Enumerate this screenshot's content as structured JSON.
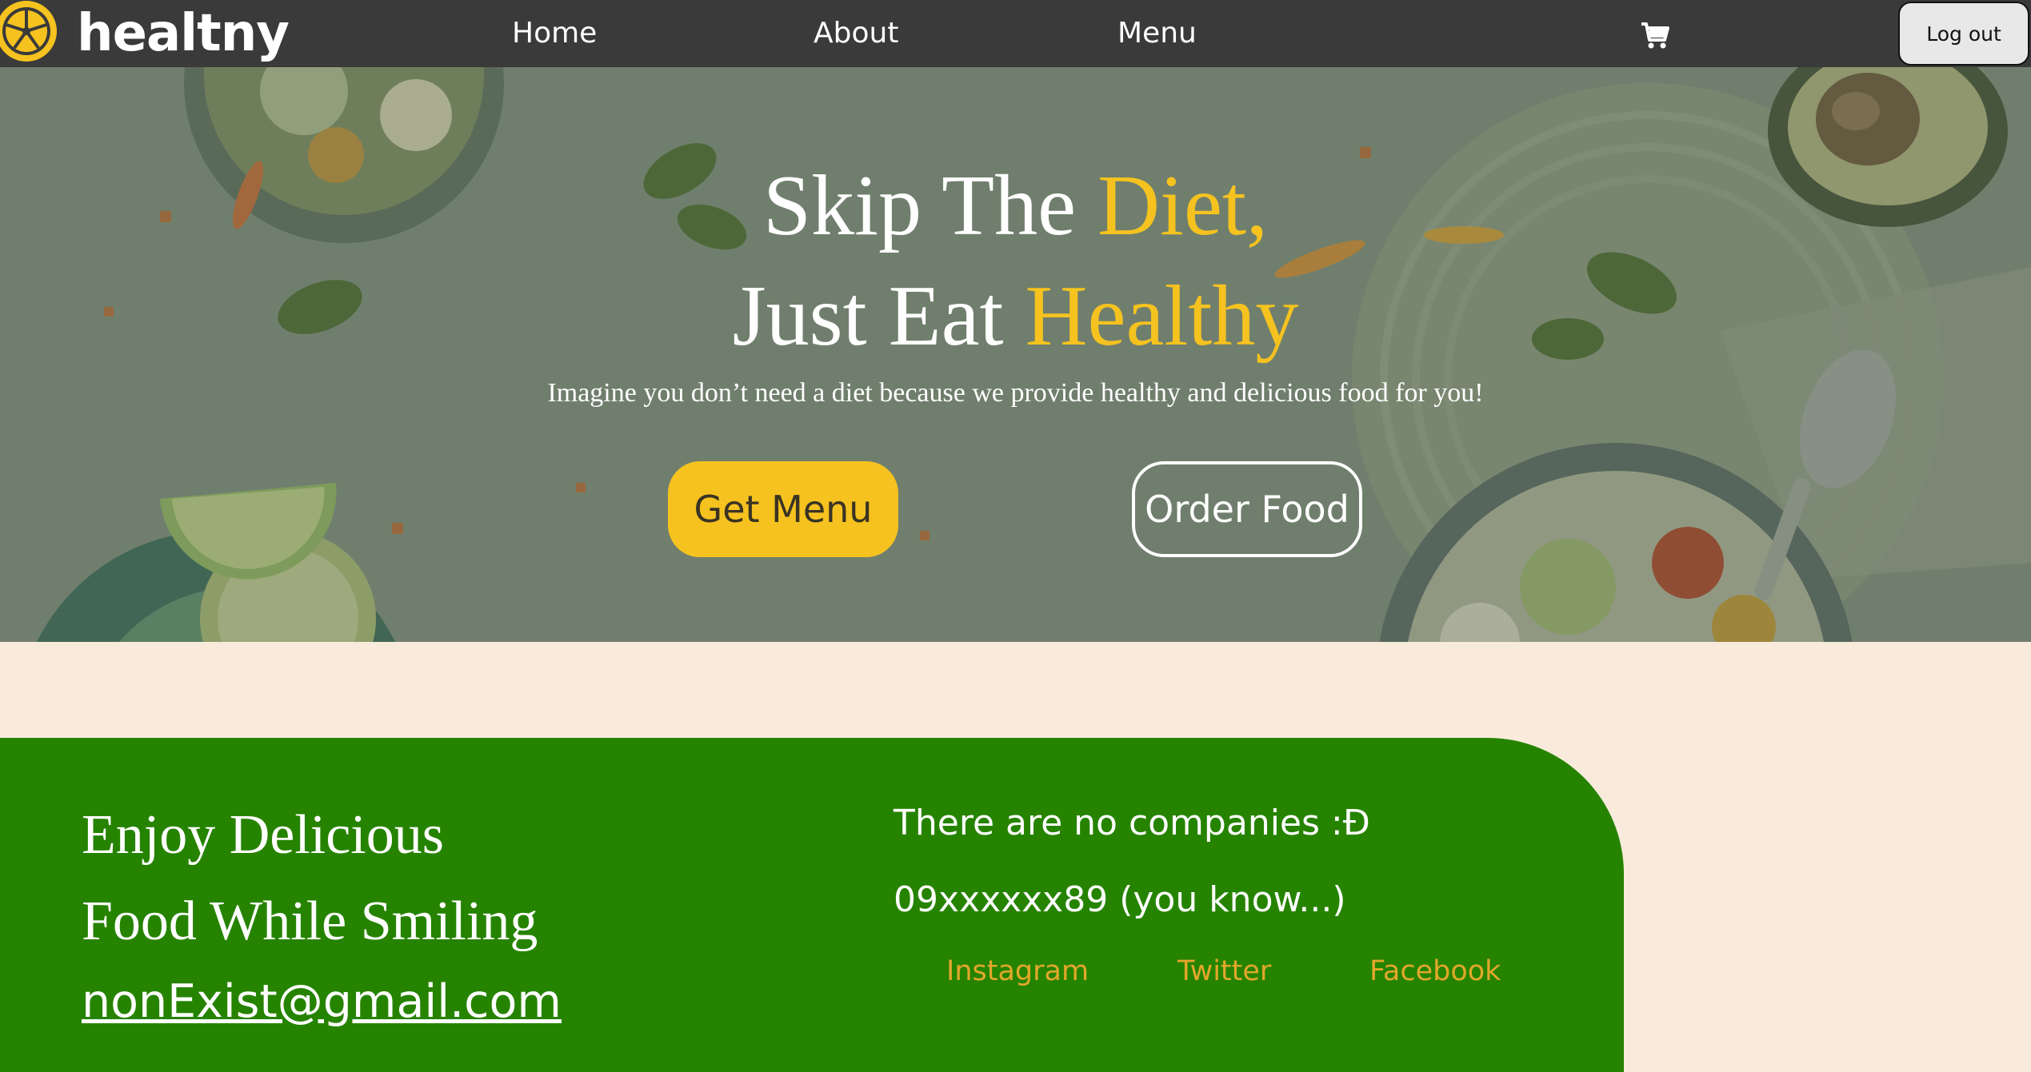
{
  "brand": {
    "name": "healtny",
    "accent": "#f5c21f"
  },
  "nav": {
    "links": [
      "Home",
      "About",
      "Menu"
    ],
    "cart_icon": "cart-icon",
    "logout_label": "Log out"
  },
  "hero": {
    "title_line1_a": "Skip The ",
    "title_line1_b": "Diet,",
    "title_line2_a": "Just Eat ",
    "title_line2_b": "Healthy",
    "subtitle": "Imagine you don’t need a diet because we provide healthy and delicious food for you!",
    "primary_button": "Get Menu",
    "secondary_button": "Order Food"
  },
  "footer": {
    "headline_line1": "Enjoy Delicious",
    "headline_line2": "Food While Smiling",
    "email": "nonExist@gmail.com",
    "companies_text": "There are no companies :Đ",
    "phone_text": "09xxxxxx89 (you know...)",
    "social_links": [
      "Instagram",
      "Twitter",
      "Facebook"
    ],
    "background_color": "#268300",
    "social_color": "#e2a72a"
  }
}
